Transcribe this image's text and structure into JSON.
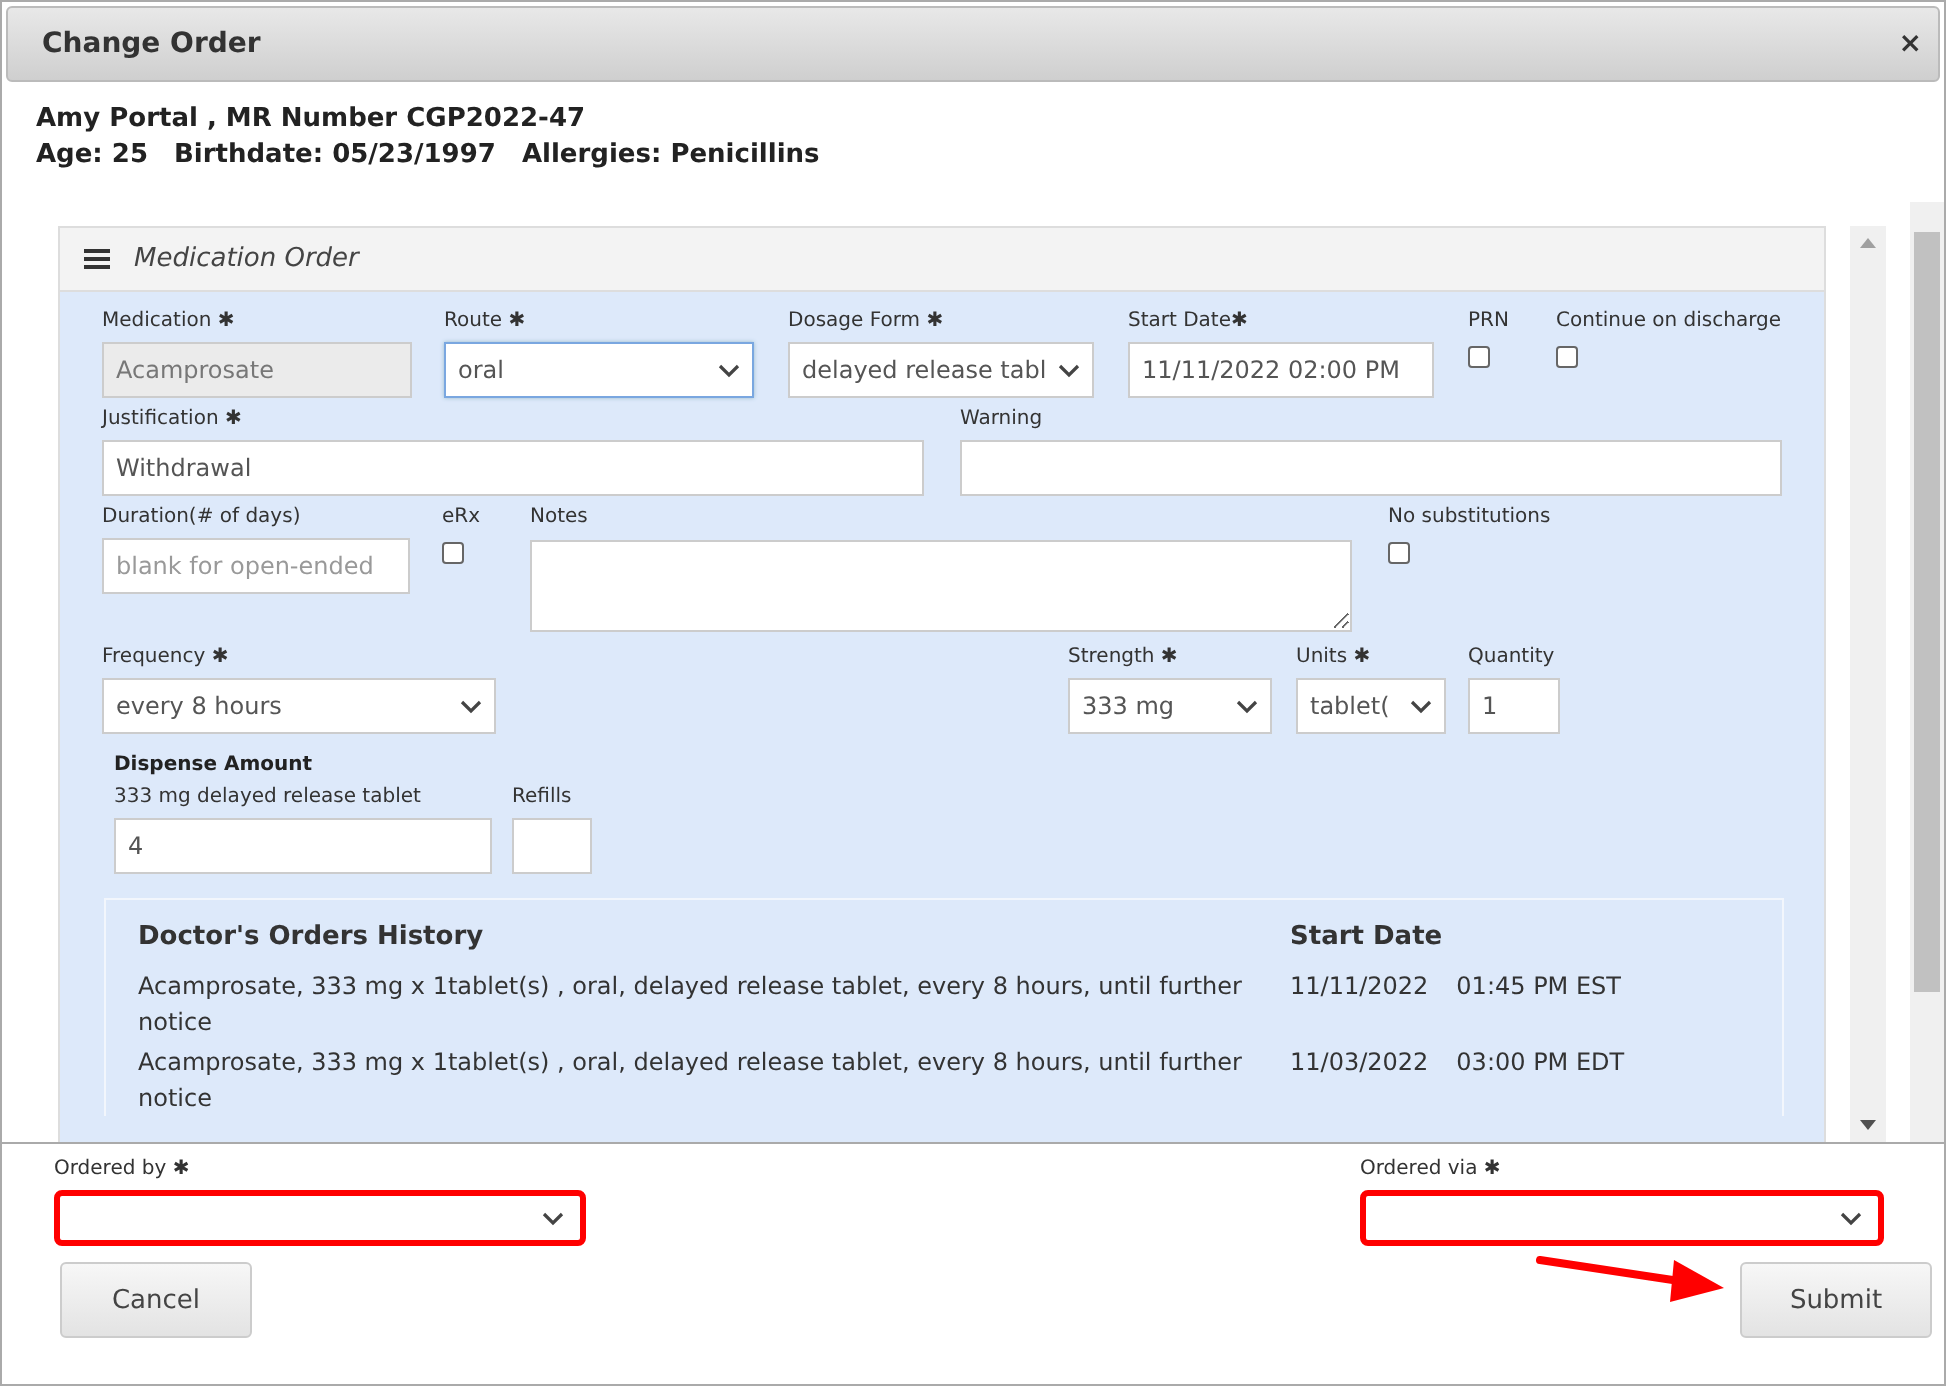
{
  "window": {
    "title": "Change Order",
    "close": "×"
  },
  "patient": {
    "line1": "Amy Portal , MR Number CGP2022-47",
    "line2": [
      "Age: 25",
      "Birthdate: 05/23/1997",
      "Allergies: Penicillins"
    ]
  },
  "panel": {
    "title": "Medication Order",
    "rows": [
      [
        {
          "kind": "text",
          "label": "Medication ✱",
          "value": "Acamprosate",
          "disabled": true,
          "focused": false
        },
        {
          "kind": "select",
          "label": "Route ✱",
          "value": "oral",
          "focused": true
        },
        {
          "kind": "select",
          "label": "Dosage Form ✱",
          "value": "delayed release tabl",
          "focused": false
        },
        {
          "kind": "text",
          "label": "Start Date✱",
          "value": "11/11/2022 02:00 PM",
          "disabled": false,
          "focused": false
        },
        {
          "kind": "checkbox",
          "label": "PRN",
          "checked": false
        },
        {
          "kind": "checkbox",
          "label": "Continue on discharge",
          "checked": false
        }
      ],
      [
        {
          "kind": "text",
          "label": "Justification ✱",
          "value": "Withdrawal",
          "disabled": false,
          "focused": false
        },
        {
          "kind": "text",
          "label": "Warning",
          "disabled": false,
          "focused": false
        }
      ],
      [
        {
          "kind": "text",
          "label": "Duration(# of days)",
          "placeholder": "blank for open-ended",
          "disabled": false,
          "focused": false
        },
        {
          "kind": "checkbox",
          "label": "eRx",
          "checked": false
        },
        {
          "kind": "textarea",
          "label": "Notes"
        },
        {
          "kind": "checkbox",
          "label": "No substitutions",
          "checked": false
        }
      ],
      [
        {
          "kind": "select",
          "label": "Frequency ✱",
          "value": "every 8 hours",
          "focused": false
        },
        {
          "kind": "select",
          "label": "Strength ✱",
          "value": "333 mg",
          "focused": false
        },
        {
          "kind": "select",
          "label": "Units ✱",
          "value": "tablet(",
          "focused": false
        },
        {
          "kind": "text",
          "label": "Quantity",
          "value": "1",
          "disabled": false,
          "focused": false
        }
      ]
    ],
    "dispense": {
      "title": "Dispense Amount",
      "fields": [
        {
          "kind": "text",
          "label": "333 mg delayed release tablet",
          "value": "4",
          "disabled": false,
          "focused": false
        },
        {
          "kind": "text",
          "label": "Refills",
          "disabled": false,
          "focused": false
        }
      ]
    },
    "history": {
      "columns": [
        "Doctor's Orders History",
        "Start Date"
      ],
      "rows": [
        {
          "order": "Acamprosate, 333 mg x 1tablet(s) , oral, delayed release tablet, every 8 hours, until further notice",
          "date": "11/11/2022",
          "time": "01:45 PM EST"
        },
        {
          "order": "Acamprosate, 333 mg x 1tablet(s) , oral, delayed release tablet, every 8 hours, until further notice",
          "date": "11/03/2022",
          "time": "03:00 PM EDT"
        }
      ]
    }
  },
  "footer": {
    "fields": [
      {
        "label": "Ordered by ✱",
        "highlighted": true
      },
      {
        "label": "Ordered via ✱",
        "highlighted": true
      }
    ],
    "buttons": [
      {
        "label": "Cancel"
      },
      {
        "label": "Submit"
      }
    ],
    "arrow": true
  }
}
